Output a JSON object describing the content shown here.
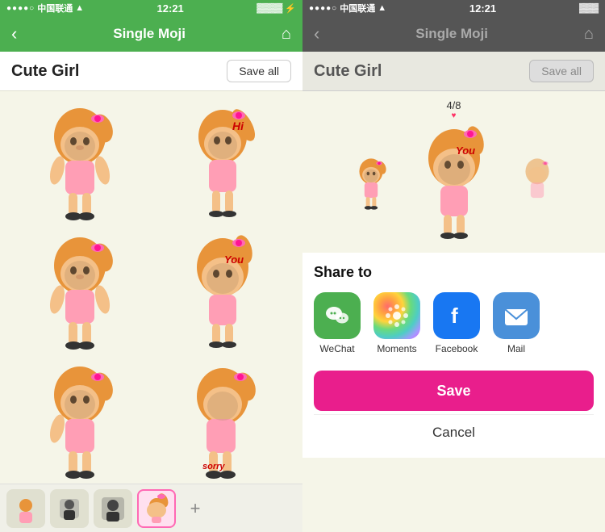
{
  "left": {
    "status": {
      "carrier": "中国联通",
      "time": "12:21",
      "wifi": "▲▼",
      "battery": "🔋"
    },
    "nav": {
      "back": "‹",
      "title": "Single Moji",
      "home": "⌂"
    },
    "header": {
      "title": "Cute Girl",
      "saveAll": "Save all"
    },
    "stickers": [
      {
        "id": 1,
        "text": "",
        "tag": ""
      },
      {
        "id": 2,
        "text": "Hi",
        "tag": "hi"
      },
      {
        "id": 3,
        "text": "",
        "tag": ""
      },
      {
        "id": 4,
        "text": "You",
        "tag": "you"
      },
      {
        "id": 5,
        "text": "",
        "tag": ""
      },
      {
        "id": 6,
        "text": "sorry",
        "tag": "sorry"
      }
    ],
    "bottomTabs": [
      {
        "id": 1,
        "label": "tab1",
        "active": false
      },
      {
        "id": 2,
        "label": "tab2",
        "active": false
      },
      {
        "id": 3,
        "label": "tab3",
        "active": false
      },
      {
        "id": 4,
        "label": "tab4",
        "active": true
      }
    ],
    "addLabel": "+"
  },
  "right": {
    "status": {
      "carrier": "中国联通",
      "time": "12:21",
      "battery": "🔋"
    },
    "nav": {
      "back": "‹",
      "title": "Single Moji",
      "home": "⌂"
    },
    "header": {
      "title": "Cute Girl",
      "saveAll": "Save all"
    },
    "counter": {
      "text": "4/8",
      "heart": "♥"
    },
    "share": {
      "title": "Share to",
      "items": [
        {
          "id": "wechat",
          "label": "WeChat",
          "icon": "wechat"
        },
        {
          "id": "moments",
          "label": "Moments",
          "icon": "moments"
        },
        {
          "id": "facebook",
          "label": "Facebook",
          "icon": "facebook"
        },
        {
          "id": "mail",
          "label": "Mail",
          "icon": "mail"
        }
      ]
    },
    "saveButton": "Save",
    "cancelButton": "Cancel"
  }
}
